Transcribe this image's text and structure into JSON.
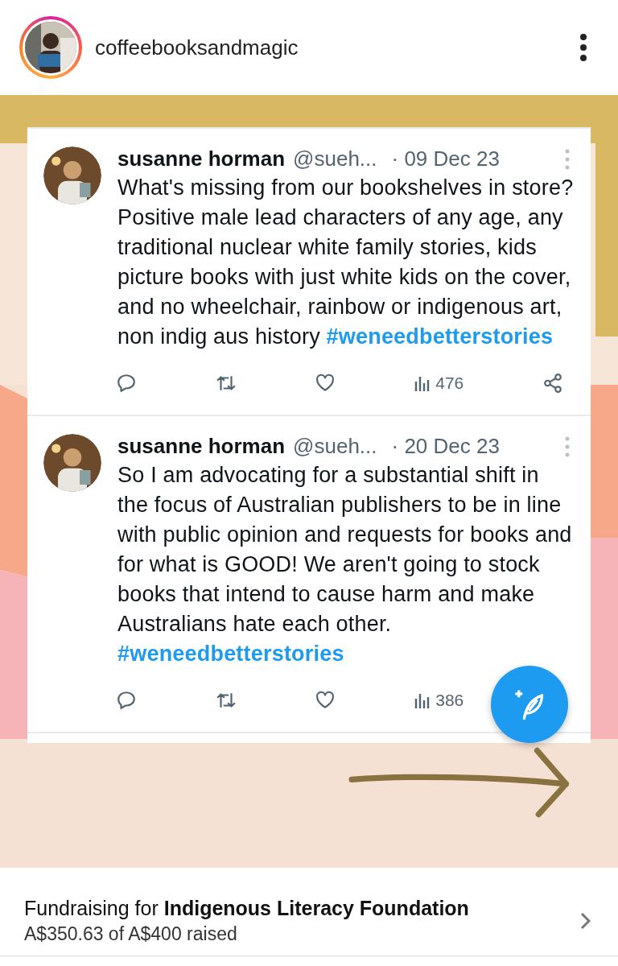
{
  "post_header": {
    "username": "coffeebooksandmagic"
  },
  "tweets": [
    {
      "name": "susanne horman",
      "handle": "@sueh...",
      "date": "· 09 Dec 23",
      "text": "What's missing from our bookshelves in store? Positive male lead characters of any age, any traditional nuclear white family stories, kids picture books with just white kids on the cover, and no wheelchair, rainbow or indigenous art, non indig aus history",
      "hashtag": "#weneedbetterstories",
      "views": "476"
    },
    {
      "name": "susanne horman",
      "handle": "@sueh...",
      "date": "· 20 Dec 23",
      "text": "So I am advocating for a substantial shift in the focus of Australian publishers to be in line with public opinion and requests for books and for what is GOOD! We aren't going to stock books that intend to cause harm and make Australians hate each other.",
      "hashtag": "#weneedbetterstories",
      "views": "386"
    }
  ],
  "fundraiser": {
    "title": "Fundraising for **Indigenous Literacy Foundation**",
    "progress": "A$350.63 of A$400 raised"
  }
}
